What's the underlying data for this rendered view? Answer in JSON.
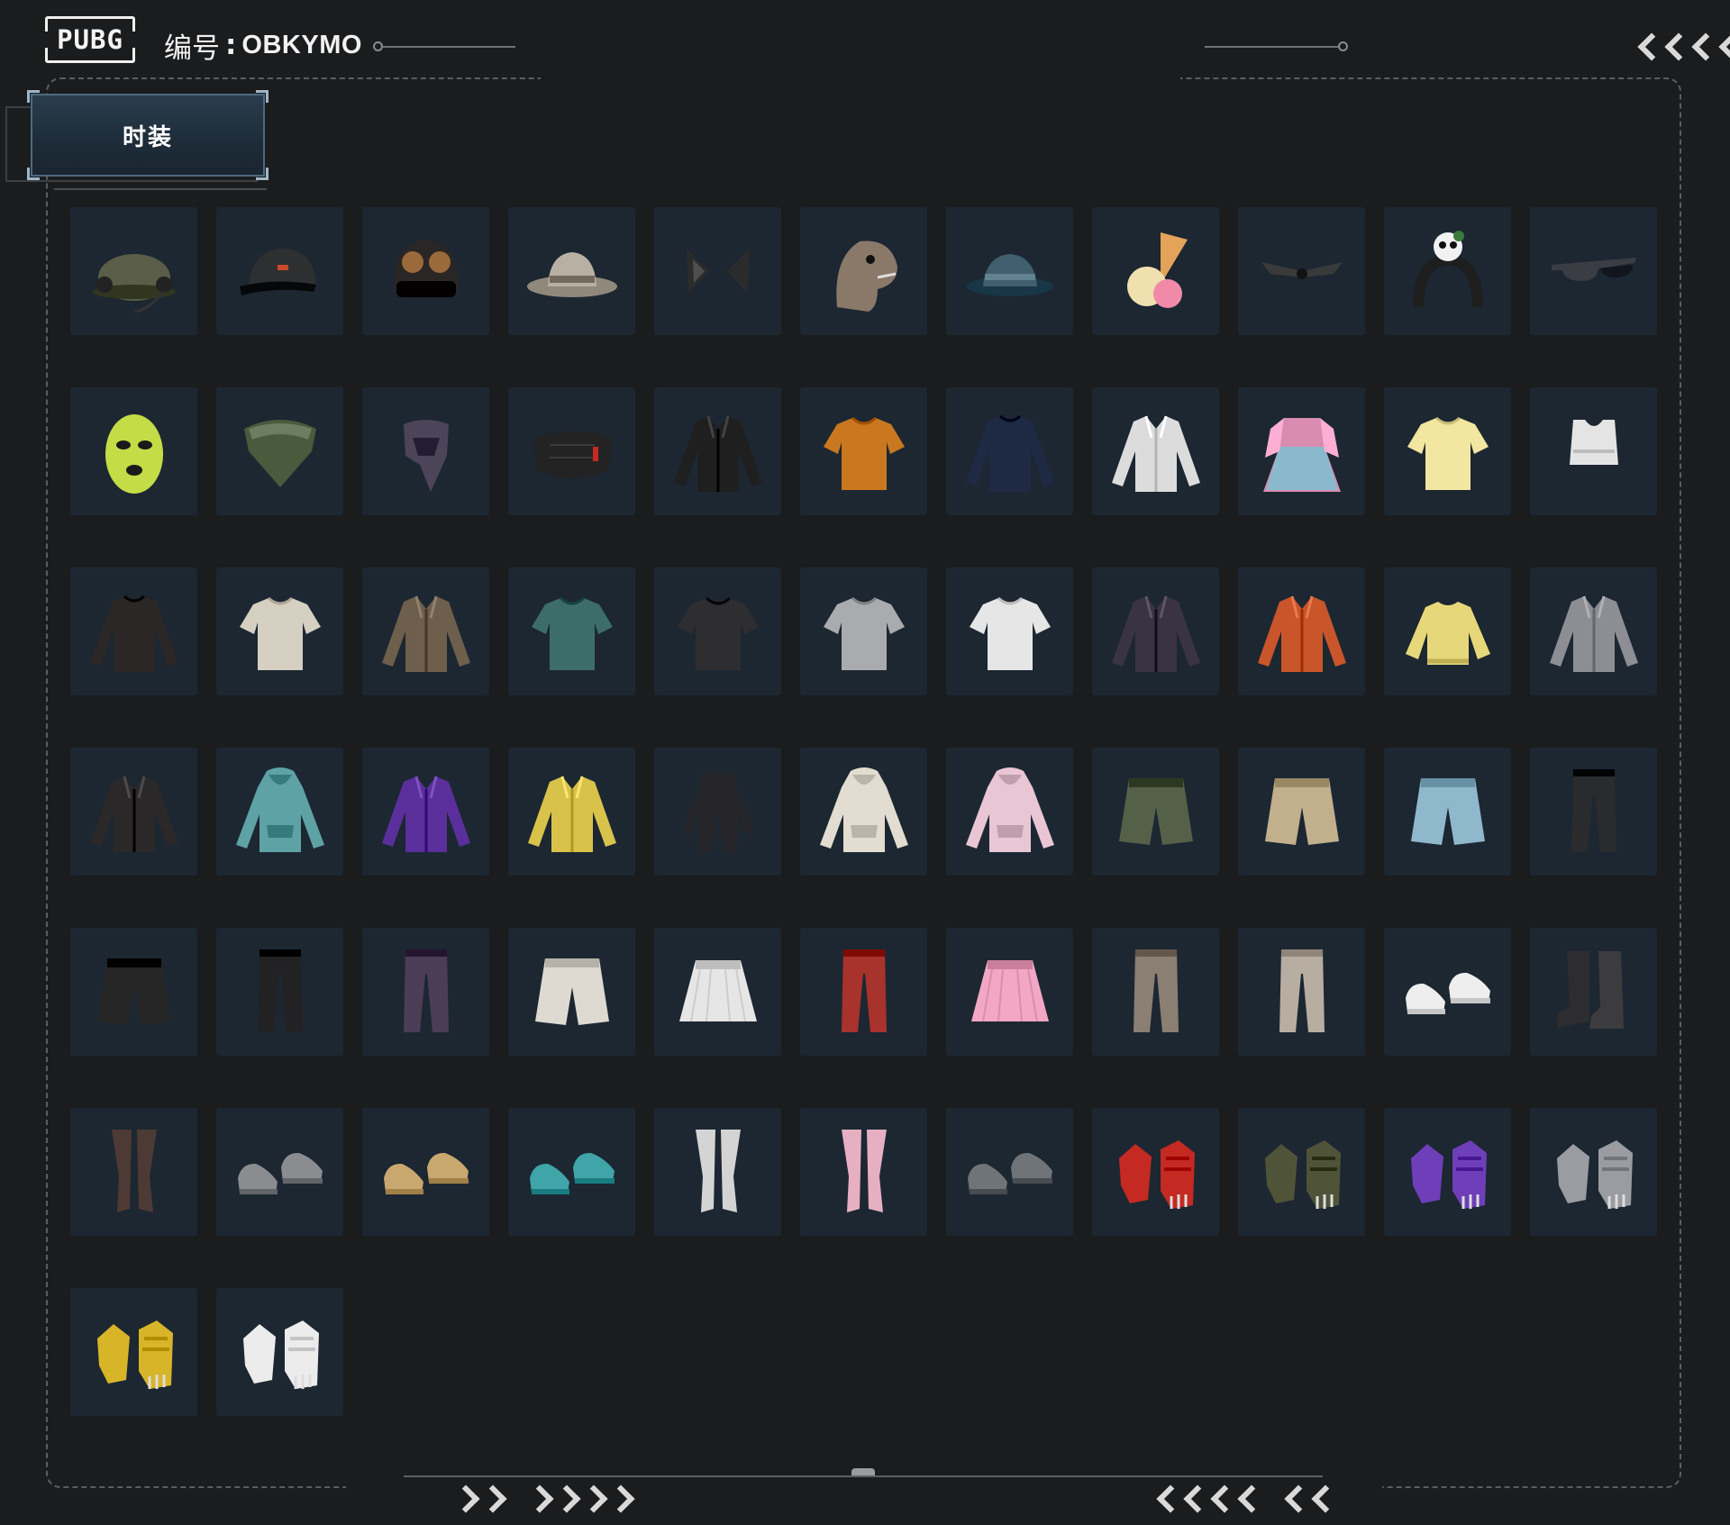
{
  "header": {
    "logo_text": "PUBG",
    "account_label": "编号",
    "account_sep": ":",
    "account_id": "OBKYMO"
  },
  "category_tab": {
    "label": "时装"
  },
  "grid": {
    "columns": 11
  },
  "colors": {
    "background": "#1b1c1e",
    "cell": "#1c2732",
    "tab": "#233444",
    "frame": "#5b5d61"
  },
  "items": [
    {
      "icon": "headset-cap-icon",
      "kind": "hat",
      "color": "#5a5d48"
    },
    {
      "icon": "black-cap-icon",
      "kind": "cap",
      "color": "#2e2f31"
    },
    {
      "icon": "goggles-beanie-icon",
      "kind": "beanie",
      "color": "#2a2625"
    },
    {
      "icon": "plaid-fedora-icon",
      "kind": "fedora",
      "color": "#b9b0a4"
    },
    {
      "icon": "cat-ears-icon",
      "kind": "ears",
      "color": "#2b2b2b"
    },
    {
      "icon": "dinosaur-mask-icon",
      "kind": "dino",
      "color": "#8a7868"
    },
    {
      "icon": "bucket-hat-icon",
      "kind": "bucket",
      "color": "#3f5e6e"
    },
    {
      "icon": "ice-cream-hat-icon",
      "kind": "icecream",
      "color": "#e3a45a"
    },
    {
      "icon": "bat-wings-icon",
      "kind": "wings",
      "color": "#3a3a3a"
    },
    {
      "icon": "panda-headband-icon",
      "kind": "headband",
      "color": "#1e1e1e"
    },
    {
      "icon": "sunglasses-icon",
      "kind": "glasses",
      "color": "#3a3d44"
    },
    {
      "icon": "green-balaclava-icon",
      "kind": "balaclava",
      "color": "#c4dc45"
    },
    {
      "icon": "camo-bandana-icon",
      "kind": "bandana",
      "color": "#4a5a3c"
    },
    {
      "icon": "purple-scarf-icon",
      "kind": "scarf",
      "color": "#4c4458"
    },
    {
      "icon": "black-face-mask-icon",
      "kind": "mask",
      "color": "#232323"
    },
    {
      "icon": "black-track-jacket-icon",
      "kind": "jacket",
      "color": "#1f1f20"
    },
    {
      "icon": "orange-graphic-tee-icon",
      "kind": "tee",
      "color": "#c9781f"
    },
    {
      "icon": "navy-turtleneck-icon",
      "kind": "longsleeve",
      "color": "#1e2a44"
    },
    {
      "icon": "white-shirt-vest-icon",
      "kind": "jacket",
      "color": "#dcdcdc"
    },
    {
      "icon": "pink-fur-dress-icon",
      "kind": "dress",
      "color": "#d98cb0"
    },
    {
      "icon": "chick-raglan-tee-icon",
      "kind": "tee",
      "color": "#f2e6a0"
    },
    {
      "icon": "white-crop-top-icon",
      "kind": "crop",
      "color": "#e4e4e4"
    },
    {
      "icon": "black-mesh-longsleeve-icon",
      "kind": "longsleeve",
      "color": "#2b2726"
    },
    {
      "icon": "embroidered-shirt-icon",
      "kind": "tee",
      "color": "#d6d0c2"
    },
    {
      "icon": "brown-vest-jacket-icon",
      "kind": "jacket",
      "color": "#6e5e4c"
    },
    {
      "icon": "floral-shirt-icon",
      "kind": "tee",
      "color": "#3d6d6a"
    },
    {
      "icon": "black-print-tee-icon",
      "kind": "tee",
      "color": "#2e2d2f"
    },
    {
      "icon": "grey-tee-icon",
      "kind": "tee",
      "color": "#a9abae"
    },
    {
      "icon": "white-tee-icon",
      "kind": "tee",
      "color": "#e6e6e6"
    },
    {
      "icon": "cyber-jacket-icon",
      "kind": "jacket",
      "color": "#3a3342"
    },
    {
      "icon": "orange-hooded-jacket-icon",
      "kind": "jacket",
      "color": "#c9552a"
    },
    {
      "icon": "yellow-fuzzy-sweater-icon",
      "kind": "sweater",
      "color": "#e6d87a"
    },
    {
      "icon": "grey-orange-jacket-icon",
      "kind": "jacket",
      "color": "#8c8e94"
    },
    {
      "icon": "quilted-leather-jacket-icon",
      "kind": "jacket",
      "color": "#2a2828"
    },
    {
      "icon": "teal-duck-hoodie-icon",
      "kind": "hoodie",
      "color": "#5fa2a6"
    },
    {
      "icon": "purple-racing-jacket-icon",
      "kind": "jacket",
      "color": "#5a2f9c"
    },
    {
      "icon": "yellow-white-jacket-icon",
      "kind": "jacket",
      "color": "#d8c24a"
    },
    {
      "icon": "black-jumpsuit-icon",
      "kind": "jumpsuit",
      "color": "#26262a"
    },
    {
      "icon": "cream-hoodie-icon",
      "kind": "hoodie",
      "color": "#e2ddd0"
    },
    {
      "icon": "pink-white-hoodie-icon",
      "kind": "hoodie",
      "color": "#e9c6d4"
    },
    {
      "icon": "green-basketball-shorts-icon",
      "kind": "shorts",
      "color": "#556048"
    },
    {
      "icon": "khaki-cargo-shorts-icon",
      "kind": "shorts",
      "color": "#c2b08c"
    },
    {
      "icon": "denim-shorts-icon",
      "kind": "shorts",
      "color": "#8fb8cc"
    },
    {
      "icon": "black-cargo-pants-icon",
      "kind": "pants",
      "color": "#2a2b2d"
    },
    {
      "icon": "black-chain-shorts-icon",
      "kind": "shorts",
      "color": "#262626"
    },
    {
      "icon": "black-skinny-pants-icon",
      "kind": "pants",
      "color": "#222224"
    },
    {
      "icon": "purple-cargo-pants-icon",
      "kind": "pants",
      "color": "#4c3d56"
    },
    {
      "icon": "white-belted-shorts-icon",
      "kind": "shorts",
      "color": "#dedad2"
    },
    {
      "icon": "white-pleated-skirt-icon",
      "kind": "skirt",
      "color": "#e6e6e6"
    },
    {
      "icon": "red-camo-pants-icon",
      "kind": "pants",
      "color": "#a8322c"
    },
    {
      "icon": "pink-pleated-skirt-icon",
      "kind": "skirt",
      "color": "#f2a8c4"
    },
    {
      "icon": "taupe-slim-pants-icon",
      "kind": "pants",
      "color": "#8b7e72"
    },
    {
      "icon": "beige-slim-pants-icon",
      "kind": "pants",
      "color": "#b7ada1"
    },
    {
      "icon": "white-sneakers-icon",
      "kind": "shoes",
      "color": "#eeeeee"
    },
    {
      "icon": "black-tall-boots-icon",
      "kind": "boots",
      "color": "#2d2d2f"
    },
    {
      "icon": "fishnet-stockings-icon",
      "kind": "legs",
      "color": "#4e3a34"
    },
    {
      "icon": "grey-orange-sneakers-icon",
      "kind": "shoes",
      "color": "#8a8c90"
    },
    {
      "icon": "tan-work-boots-icon",
      "kind": "shoes",
      "color": "#c9a870"
    },
    {
      "icon": "teal-clogs-icon",
      "kind": "shoes",
      "color": "#3fa5a8"
    },
    {
      "icon": "white-thigh-boots-icon",
      "kind": "legs",
      "color": "#d4d4d4"
    },
    {
      "icon": "pink-lace-boots-icon",
      "kind": "legs",
      "color": "#e6b0c2"
    },
    {
      "icon": "grey-combat-boots-icon",
      "kind": "shoes",
      "color": "#6e7478"
    },
    {
      "icon": "red-moto-gloves-icon",
      "kind": "gloves",
      "color": "#c42a22"
    },
    {
      "icon": "camo-gloves-icon",
      "kind": "gloves",
      "color": "#4f5338"
    },
    {
      "icon": "purple-gloves-icon",
      "kind": "gloves",
      "color": "#6e3fb8"
    },
    {
      "icon": "silver-knuckle-gloves-icon",
      "kind": "gloves",
      "color": "#9a9ca2"
    },
    {
      "icon": "yellow-moto-gloves-icon",
      "kind": "gloves",
      "color": "#d8b528"
    },
    {
      "icon": "panda-gloves-icon",
      "kind": "gloves",
      "color": "#ececec"
    }
  ]
}
